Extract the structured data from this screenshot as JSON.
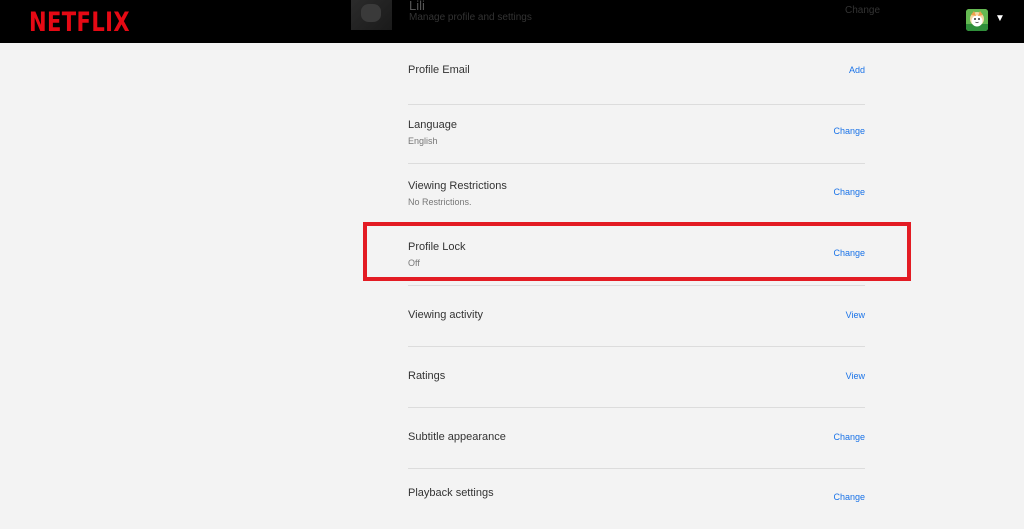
{
  "header": {
    "logo": "NETFLIX",
    "profile_name": "Lili",
    "profile_sub": "Manage profile and settings",
    "profile_right": "Change"
  },
  "settings": {
    "profile_email": {
      "title": "Profile Email",
      "action": "Add"
    },
    "language": {
      "title": "Language",
      "value": "English",
      "action": "Change"
    },
    "viewing_restrictions": {
      "title": "Viewing Restrictions",
      "value": "No Restrictions.",
      "action": "Change"
    },
    "profile_lock": {
      "title": "Profile Lock",
      "value": "Off",
      "action": "Change"
    },
    "viewing_activity": {
      "title": "Viewing activity",
      "action": "View"
    },
    "ratings": {
      "title": "Ratings",
      "action": "View"
    },
    "subtitle_appearance": {
      "title": "Subtitle appearance",
      "action": "Change"
    },
    "playback_settings": {
      "title": "Playback settings",
      "action": "Change"
    }
  },
  "colors": {
    "brand": "#e50914",
    "highlight": "#e31b23",
    "link": "#1a73e8"
  }
}
